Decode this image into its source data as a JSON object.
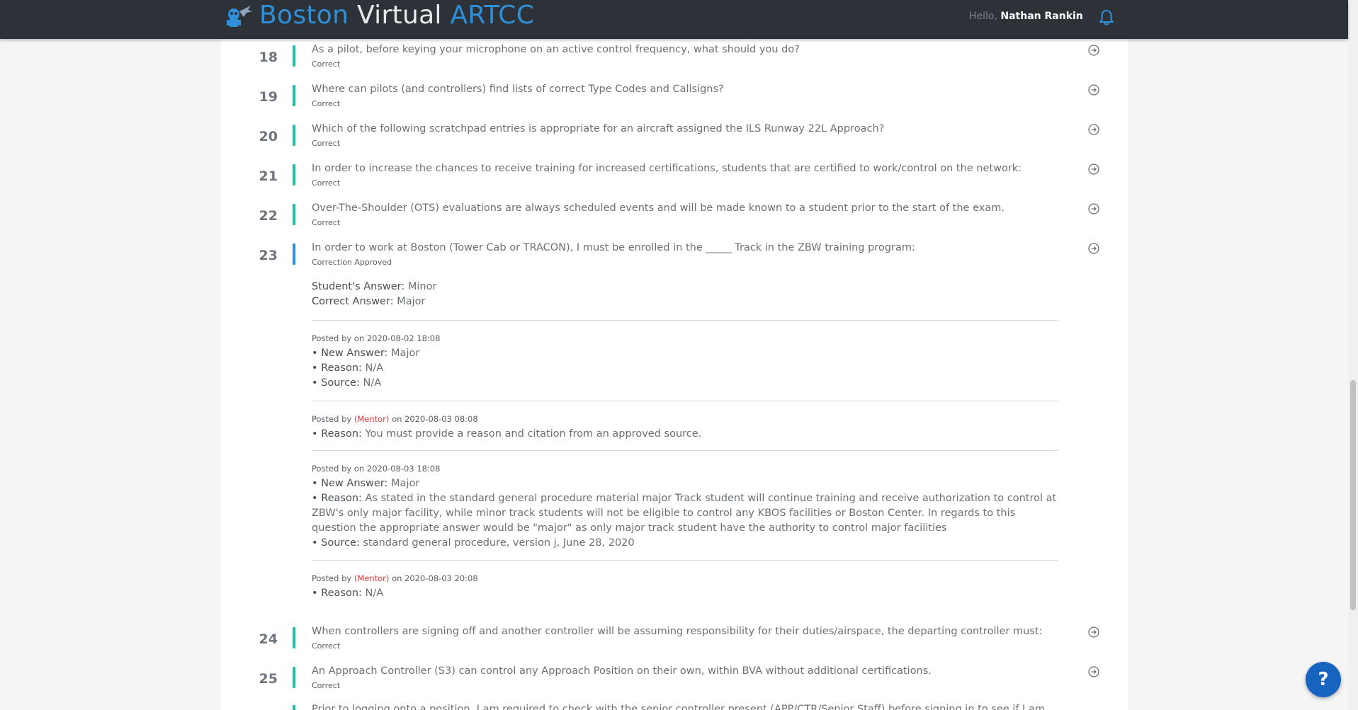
{
  "header": {
    "brand_part1": "Boston",
    "brand_part2": "Virtual",
    "brand_part3": "ARTCC",
    "hello": "Hello,",
    "username": "Nathan Rankin"
  },
  "questions": [
    {
      "num": "18",
      "text": "As a pilot, before keying your microphone on an active control frequency, what should you do?",
      "status": "Correct"
    },
    {
      "num": "19",
      "text": "Where can pilots (and controllers) find lists of correct Type Codes and Callsigns?",
      "status": "Correct"
    },
    {
      "num": "20",
      "text": "Which of the following scratchpad entries is appropriate for an aircraft assigned the ILS Runway 22L Approach?",
      "status": "Correct"
    },
    {
      "num": "21",
      "text": "In order to increase the chances to receive training for increased certifications, students that are certified to work/control on the network:",
      "status": "Correct"
    },
    {
      "num": "22",
      "text": "Over-The-Shoulder (OTS) evaluations are always scheduled events and will be made known to a student prior to the start of the exam.",
      "status": "Correct"
    },
    {
      "num": "23",
      "text": "In order to work at Boston (Tower Cab or TRACON), I must be enrolled in the _____ Track in the ZBW training program:",
      "status": "Correction Approved"
    },
    {
      "num": "24",
      "text": "When controllers are signing off and another controller will be assuming responsibility for their duties/airspace, the departing controller must:",
      "status": "Correct"
    },
    {
      "num": "25",
      "text": "An Approach Controller (S3) can control any Approach Position on their own, within BVA without additional certifications.",
      "status": "Correct"
    },
    {
      "text": "Prior to logging onto a position, I am required to check with the senior controller present (APP/CTR/Senior Staff) before signing in to see if I am"
    }
  ],
  "q23_detail": {
    "student_answer_label": "Student's Answer:",
    "student_answer": "Minor",
    "correct_answer_label": "Correct Answer:",
    "correct_answer": "Major"
  },
  "posts": [
    {
      "posted_by": "Posted by",
      "meta": "on 2020-08-02 18:08",
      "new_answer_label": "• New Answer:",
      "new_answer": "Major",
      "reason_label": "• Reason:",
      "reason": "N/A",
      "source_label": "• Source:",
      "source": "N/A"
    },
    {
      "posted_by": "Posted by",
      "role": "(Mentor)",
      "meta": "on 2020-08-03 08:08",
      "reason_label": "• Reason:",
      "reason": "You must provide a reason and citation from an approved source."
    },
    {
      "posted_by": "Posted by",
      "meta": "on 2020-08-03 18:08",
      "new_answer_label": "• New Answer:",
      "new_answer": "Major",
      "reason_label": "• Reason:",
      "reason": "As stated in the standard general procedure material major Track student will continue training and receive authorization to control at ZBW's only major facility, while minor track students will not be eligible to control any KBOS facilities or Boston Center. In regards to this question the appropriate answer would be \"major\" as only major track student have the authority to control major facilities",
      "source_label": "• Source:",
      "source": "standard general procedure, version j, June 28, 2020"
    },
    {
      "posted_by": "Posted by",
      "role": "(Mentor)",
      "meta": "on 2020-08-03 20:08",
      "reason_label": "• Reason:",
      "reason": "N/A"
    }
  ],
  "help_button": "?",
  "colors": {
    "accent": "#2f8fd8",
    "correct_bar": "#24c0a0",
    "navbar": "#2d3238",
    "mentor": "#e03a3a",
    "help": "#1764c0"
  }
}
